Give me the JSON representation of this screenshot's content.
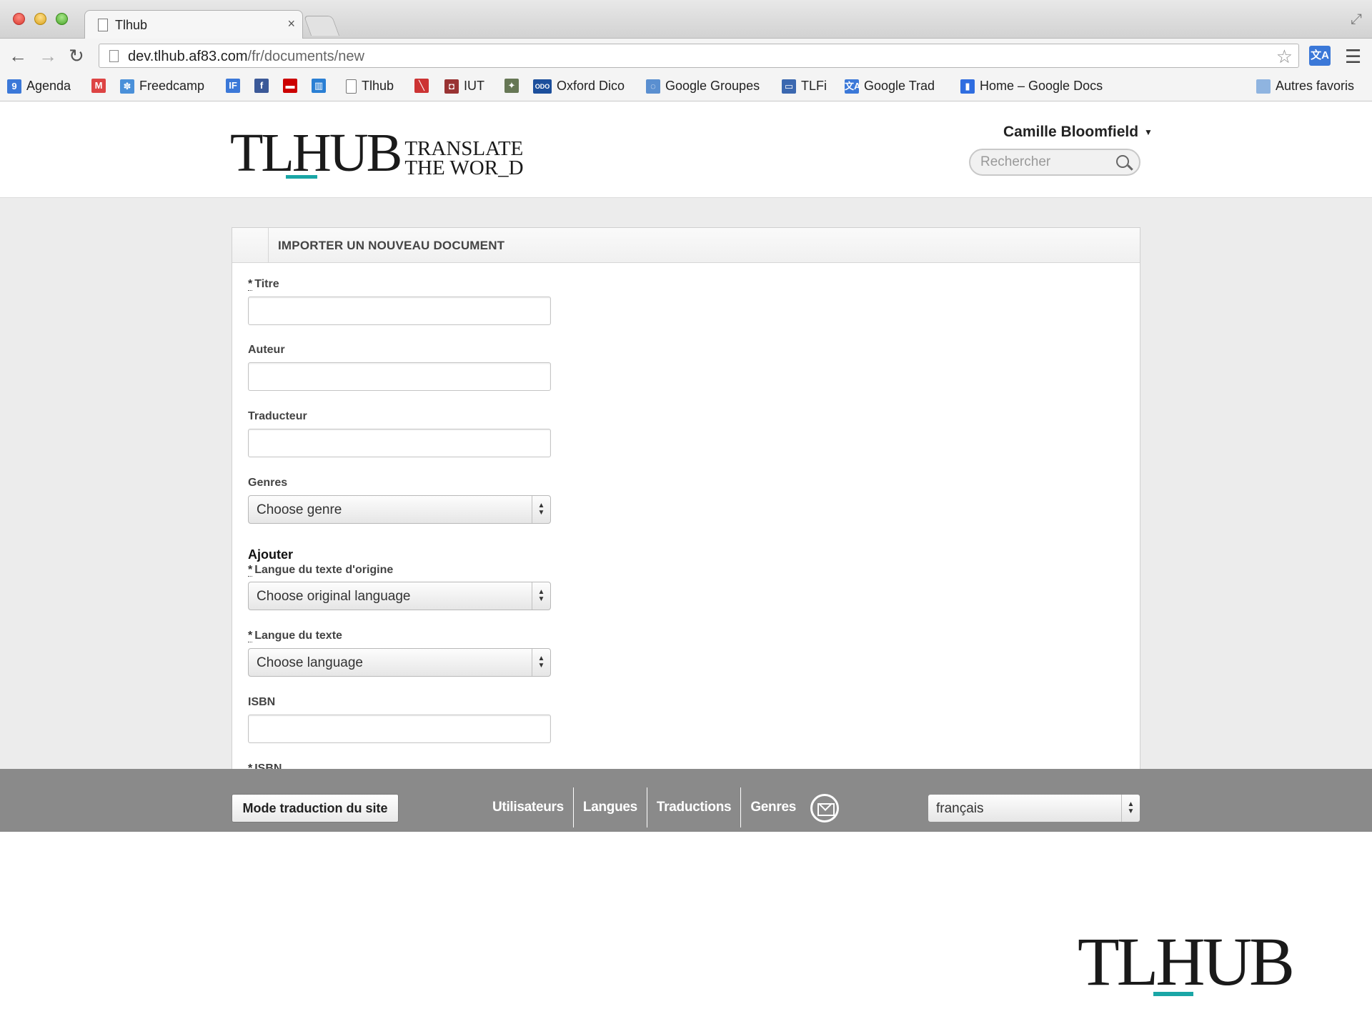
{
  "browser": {
    "tab_title": "Tlhub",
    "tab_close": "×",
    "url_host": "dev.tlhub.af83.com",
    "url_path": "/fr/documents/new",
    "bookmarks": [
      {
        "label": "Agenda",
        "icon": "calendar-icon",
        "color": "#3b78d8",
        "glyph": "9"
      },
      {
        "label": "",
        "icon": "gmail-icon",
        "color": "#d44",
        "glyph": "M"
      },
      {
        "label": "Freedcamp",
        "icon": "freedcamp-icon",
        "color": "#4a90d9",
        "glyph": "✽"
      },
      {
        "label": "",
        "icon": "if-icon",
        "color": "#3b78d8",
        "glyph": "IF"
      },
      {
        "label": "",
        "icon": "facebook-icon",
        "color": "#3b5998",
        "glyph": "f"
      },
      {
        "label": "",
        "icon": "red-flag-icon",
        "color": "#cc0000",
        "glyph": "▬"
      },
      {
        "label": "",
        "icon": "trello-icon",
        "color": "#2a7fd4",
        "glyph": "▥"
      },
      {
        "label": "Tlhub",
        "icon": "page-icon",
        "color": "#ffffff",
        "glyph": ""
      },
      {
        "label": "",
        "icon": "pdf-icon",
        "color": "#cc3333",
        "glyph": "╲"
      },
      {
        "label": "IUT",
        "icon": "iut-icon",
        "color": "#993333",
        "glyph": "◘"
      },
      {
        "label": "",
        "icon": "owl-icon",
        "color": "#667755",
        "glyph": "✦"
      },
      {
        "label": "Oxford Dico",
        "icon": "oxford-icon",
        "color": "#1c4f9c",
        "glyph": "ODO"
      },
      {
        "label": "Google Groupes",
        "icon": "groups-icon",
        "color": "#5a8fd0",
        "glyph": "◌"
      },
      {
        "label": "TLFi",
        "icon": "tlfi-icon",
        "color": "#3b68b0",
        "glyph": "▭"
      },
      {
        "label": "Google Trad",
        "icon": "translate-icon",
        "color": "#3b78d8",
        "glyph": "文A"
      },
      {
        "label": "Home – Google Docs",
        "icon": "docs-icon",
        "color": "#2f6de0",
        "glyph": "▮"
      }
    ],
    "other_bookmarks": "Autres favoris"
  },
  "header": {
    "logo_main": "TLHUB",
    "logo_tagline_1": "TRANSLATE",
    "logo_tagline_2": "THE WOR_D",
    "user_name": "Camille Bloomfield",
    "search_placeholder": "Rechercher"
  },
  "form": {
    "title": "IMPORTER UN NOUVEAU DOCUMENT",
    "required_mark": "*",
    "titre_label": "Titre",
    "auteur_label": "Auteur",
    "traducteur_label": "Traducteur",
    "genres_label": "Genres",
    "genres_value": "Choose genre",
    "ajouter_heading": "Ajouter",
    "langue_origine_label": "Langue du texte d'origine",
    "langue_origine_value": "Choose original language",
    "langue_texte_label": "Langue du texte",
    "langue_texte_value": "Choose language",
    "isbn_label": "ISBN",
    "isbn_partial_label": "ISBN"
  },
  "footer": {
    "translate_mode_button": "Mode traduction du site",
    "links": [
      "Utilisateurs",
      "Langues",
      "Traductions",
      "Genres"
    ],
    "language_value": "français"
  },
  "bottom_logo": "TLHUB",
  "colors": {
    "accent_teal": "#1aa6a6",
    "footer_gray": "#8a8a8a",
    "page_background": "#ececec"
  }
}
